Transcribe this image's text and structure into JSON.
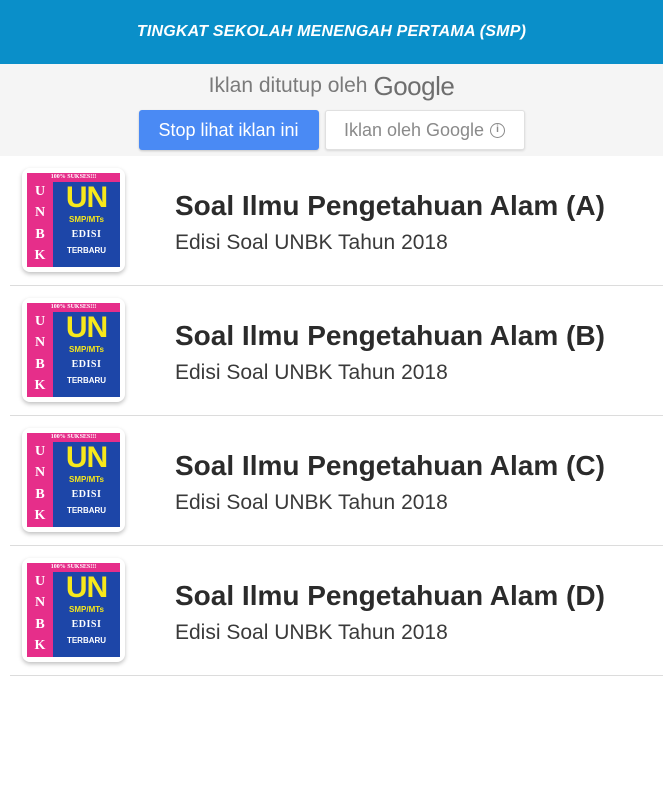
{
  "header": {
    "title": "TINGKAT SEKOLAH MENENGAH PERTAMA (SMP)",
    "background": "#0a8fc9"
  },
  "ad": {
    "closed_text": "Iklan ditutup oleh",
    "google_logo": "Google",
    "stop_button_label": "Stop lihat iklan ini",
    "by_google_button_label": "Iklan oleh Google",
    "info_icon": "info-icon",
    "accent": "#4a8af4"
  },
  "book_cover": {
    "top_banner": "100% SUKSES!!!",
    "side_letters": [
      "U",
      "N",
      "B",
      "K"
    ],
    "un_text": "UN",
    "level_text": "SMP/MTs",
    "edisi_text": "EDISI",
    "terbaru_text": "TERBARU",
    "colors": {
      "pink": "#e62e8a",
      "blue": "#1d46a8",
      "yellow": "#f7e81b"
    }
  },
  "items": [
    {
      "title": "Soal Ilmu Pengetahuan Alam (A)",
      "subtitle": "Edisi Soal UNBK Tahun 2018"
    },
    {
      "title": "Soal Ilmu Pengetahuan Alam (B)",
      "subtitle": "Edisi Soal UNBK Tahun 2018"
    },
    {
      "title": "Soal Ilmu Pengetahuan Alam (C)",
      "subtitle": "Edisi Soal UNBK Tahun 2018"
    },
    {
      "title": "Soal Ilmu Pengetahuan Alam (D)",
      "subtitle": "Edisi Soal UNBK Tahun 2018"
    }
  ]
}
